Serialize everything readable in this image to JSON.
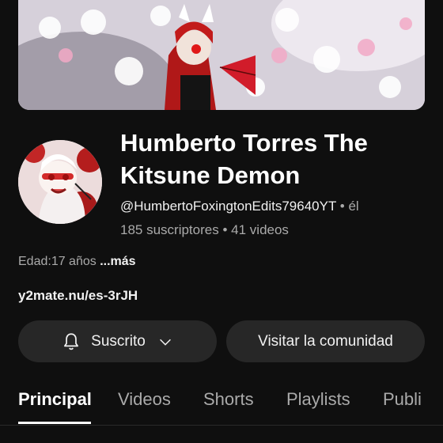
{
  "channel": {
    "name": "Humberto Torres The Kitsune Demon",
    "handle": "@HumbertoFoxingtonEdits79640YT",
    "handle_suffix": "• él",
    "subscribers": "185 suscriptores",
    "separator": "•",
    "videos": "41 videos",
    "description": "Edad:17 años",
    "more_label": "...más",
    "link": "y2mate.nu/es-3rJH"
  },
  "buttons": {
    "subscribed_label": "Suscrito",
    "community_label": "Visitar la comunidad"
  },
  "tabs": [
    {
      "label": "Principal",
      "active": true
    },
    {
      "label": "Videos",
      "active": false
    },
    {
      "label": "Shorts",
      "active": false
    },
    {
      "label": "Playlists",
      "active": false
    },
    {
      "label": "Publi",
      "active": false
    }
  ],
  "colors": {
    "background": "#0f0f0f",
    "button": "#272727",
    "text": "#f1f1f1",
    "muted": "#aaaaaa"
  }
}
